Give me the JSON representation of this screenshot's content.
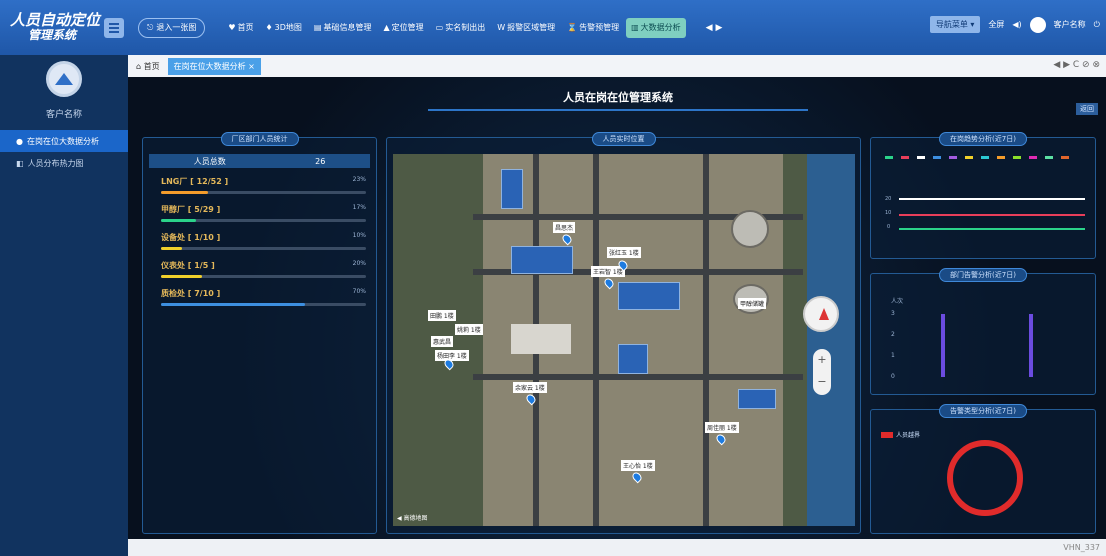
{
  "app": {
    "title_line1": "人员自动定位",
    "title_line2": "管理系统",
    "logout_label": "退入一张图"
  },
  "nav": {
    "items": [
      "首页",
      "3D地图",
      "基础信息管理",
      "定位管理",
      "实名制出出",
      "报警区域管理",
      "告警预管理",
      "大数据分析"
    ],
    "active": "大数据分析",
    "scroll": "◀ ▶"
  },
  "right_tools": {
    "nav_menu": "导航菜单 ▾",
    "fullscreen": "全屏",
    "username": "客户名称"
  },
  "sidebar": {
    "customer_name": "客户名称",
    "items": [
      "在岗在位大数据分析",
      "人员分布热力图"
    ]
  },
  "tabs": {
    "home": "首页",
    "active": "在岗在位大数据分析 ×",
    "tools": "◀ ▶ C ⊘ ⊗"
  },
  "page": {
    "title": "人员在岗在位管理系统",
    "return_label": "返回"
  },
  "dept_panel": {
    "title": "厂区部门人员统计",
    "total_label": "人员总数",
    "total_value": "26",
    "depts": [
      {
        "name": "LNG厂 [ 12/52 ]",
        "pct": "23%",
        "ratio": 0.23,
        "color": "#f39c2b"
      },
      {
        "name": "甲醇厂 [ 5/29 ]",
        "pct": "17%",
        "ratio": 0.17,
        "color": "#2bd38a"
      },
      {
        "name": "设备处 [ 1/10 ]",
        "pct": "10%",
        "ratio": 0.1,
        "color": "#f0d02b"
      },
      {
        "name": "仪表处 [ 1/5 ]",
        "pct": "20%",
        "ratio": 0.2,
        "color": "#f0d02b"
      },
      {
        "name": "质检处 [ 7/10 ]",
        "pct": "70%",
        "ratio": 0.7,
        "color": "#3d8fe0"
      }
    ]
  },
  "map_panel": {
    "title": "人员实时位置",
    "map_logo": "◀ 高德地图",
    "labels": [
      "昌思杰",
      "张红玉 1楼",
      "王岩智 1楼",
      "甲醇储罐",
      "田鹏 1楼",
      "姚莉 1楼",
      "惠武昌",
      "杨田李 1楼",
      "余家云 1楼",
      "周佳丽 1楼",
      "王心怡 1楼"
    ]
  },
  "weekly_panel": {
    "title": "在岗趋势分析(近7日)",
    "y_ticks": [
      "20",
      "10",
      "0"
    ]
  },
  "alarm_panel": {
    "title": "部门告警分析(近7日)",
    "y_axis_label": "人次",
    "y_ticks": [
      "3",
      "2",
      "1",
      "0"
    ]
  },
  "alarm_type_panel": {
    "title": "告警类型分析(近7日)",
    "legend": "人员越界"
  },
  "footer": {
    "version": "VHN_337"
  }
}
